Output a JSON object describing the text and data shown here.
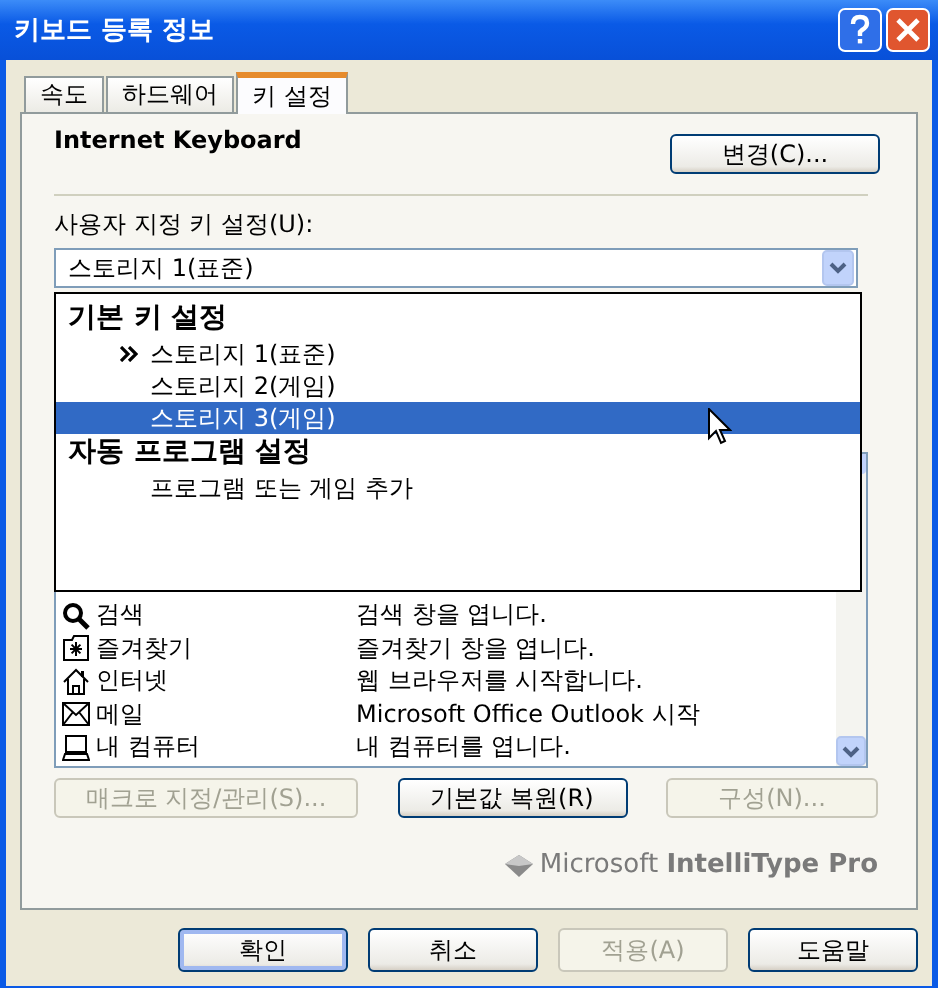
{
  "window": {
    "title": "키보드 등록 정보"
  },
  "tabs": [
    {
      "label": "속도",
      "selected": false
    },
    {
      "label": "하드웨어",
      "selected": false
    },
    {
      "label": "키 설정",
      "selected": true
    }
  ],
  "device": {
    "name": "Internet Keyboard",
    "change_button": "변경(C)..."
  },
  "custom_keys": {
    "label": "사용자 지정 키 설정(U):",
    "value": "스토리지 1(표준)"
  },
  "dropdown": {
    "groups": [
      {
        "heading": "기본 키 설정",
        "items": [
          {
            "label": "스토리지 1(표준)",
            "current": true,
            "selected": false
          },
          {
            "label": "스토리지 2(게임)",
            "current": false,
            "selected": false
          },
          {
            "label": "스토리지 3(게임)",
            "current": false,
            "selected": true
          }
        ]
      },
      {
        "heading": "자동 프로그램 설정",
        "items": [
          {
            "label": "프로그램 또는 게임 추가",
            "current": false,
            "selected": false
          }
        ]
      }
    ]
  },
  "key_list": {
    "rows": [
      {
        "kind": "search",
        "key": "검색",
        "action": "검색 창을 엽니다."
      },
      {
        "kind": "favorites",
        "key": "즐겨찾기",
        "action": "즐겨찾기 창을 엽니다."
      },
      {
        "kind": "home",
        "key": "인터넷",
        "action": "웹 브라우저를 시작합니다."
      },
      {
        "kind": "mail",
        "key": "메일",
        "action": "Microsoft Office Outlook 시작"
      },
      {
        "kind": "computer",
        "key": "내 컴퓨터",
        "action": "내 컴퓨터를 엽니다."
      }
    ]
  },
  "actions": [
    {
      "label": "매크로 지정/관리(S)...",
      "disabled": true
    },
    {
      "label": "기본값 복원(R)",
      "disabled": false
    },
    {
      "label": "구성(N)...",
      "disabled": true
    }
  ],
  "brand": {
    "text": "Microsoft **IntelliType Pro**"
  },
  "footer_buttons": [
    {
      "label": "확인",
      "disabled": false,
      "default": true
    },
    {
      "label": "취소",
      "disabled": false,
      "default": false
    },
    {
      "label": "적용(A)",
      "disabled": true,
      "default": false
    },
    {
      "label": "도움말",
      "disabled": false,
      "default": false
    }
  ]
}
